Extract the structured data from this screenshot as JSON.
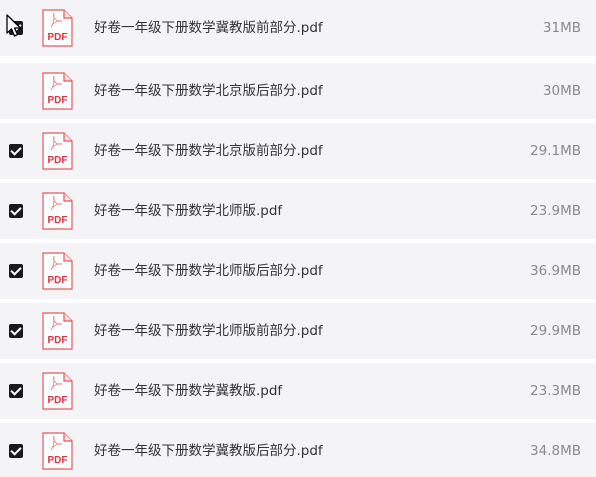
{
  "files": [
    {
      "name": "好卷一年级下册数学北京版后部分.pdf",
      "size": "30MB",
      "checked": false
    },
    {
      "name": "好卷一年级下册数学北京版前部分.pdf",
      "size": "29.1MB",
      "checked": true
    },
    {
      "name": "好卷一年级下册数学北师版.pdf",
      "size": "23.9MB",
      "checked": true
    },
    {
      "name": "好卷一年级下册数学北师版后部分.pdf",
      "size": "36.9MB",
      "checked": true
    },
    {
      "name": "好卷一年级下册数学北师版前部分.pdf",
      "size": "29.9MB",
      "checked": true
    },
    {
      "name": "好卷一年级下册数学冀教版.pdf",
      "size": "23.3MB",
      "checked": true
    },
    {
      "name": "好卷一年级下册数学冀教版后部分.pdf",
      "size": "34.8MB",
      "checked": true
    },
    {
      "name": "好卷一年级下册数学冀教版前部分.pdf",
      "size": "31MB",
      "checked": true
    }
  ],
  "icons": {
    "file_type_icon": "pdf-file-icon",
    "file_type_label": "PDF",
    "checkbox": "checkbox-checked-icon",
    "pointer": "mouse-pointer-icon"
  },
  "colors": {
    "row_background": "#f4f4f6",
    "checkbox": "#1a1a1a",
    "pdf_accent": "#d9363e",
    "file_name_text": "#333333",
    "file_size_text": "#8a8a8a"
  }
}
